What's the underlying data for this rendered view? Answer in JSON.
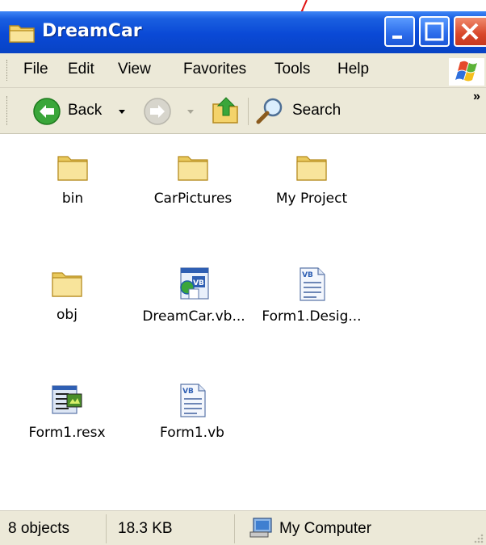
{
  "window": {
    "title": "DreamCar"
  },
  "menu": [
    "File",
    "Edit",
    "View",
    "Favorites",
    "Tools",
    "Help"
  ],
  "toolbar": {
    "back_label": "Back",
    "search_label": "Search",
    "more_glyph": "»"
  },
  "items": [
    {
      "label": "bin",
      "icon": "folder-icon"
    },
    {
      "label": "CarPictures",
      "icon": "folder-icon"
    },
    {
      "label": "My Project",
      "icon": "folder-icon"
    },
    {
      "label": "obj",
      "icon": "folder-icon"
    },
    {
      "label": "DreamCar.vb...",
      "icon": "vb-project-file-icon"
    },
    {
      "label": "Form1.Desig...",
      "icon": "vb-file-icon"
    },
    {
      "label": "Form1.resx",
      "icon": "resx-file-icon"
    },
    {
      "label": "Form1.vb",
      "icon": "vb-file-icon"
    }
  ],
  "status": {
    "count": "8 objects",
    "size": "18.3 KB",
    "location": "My Computer"
  },
  "colors": {
    "titlebar": "#0a49d6",
    "chrome": "#ece9d8",
    "folder": "#f6e08a",
    "back_button": "#3aa63a",
    "close_button": "#d8472a"
  }
}
